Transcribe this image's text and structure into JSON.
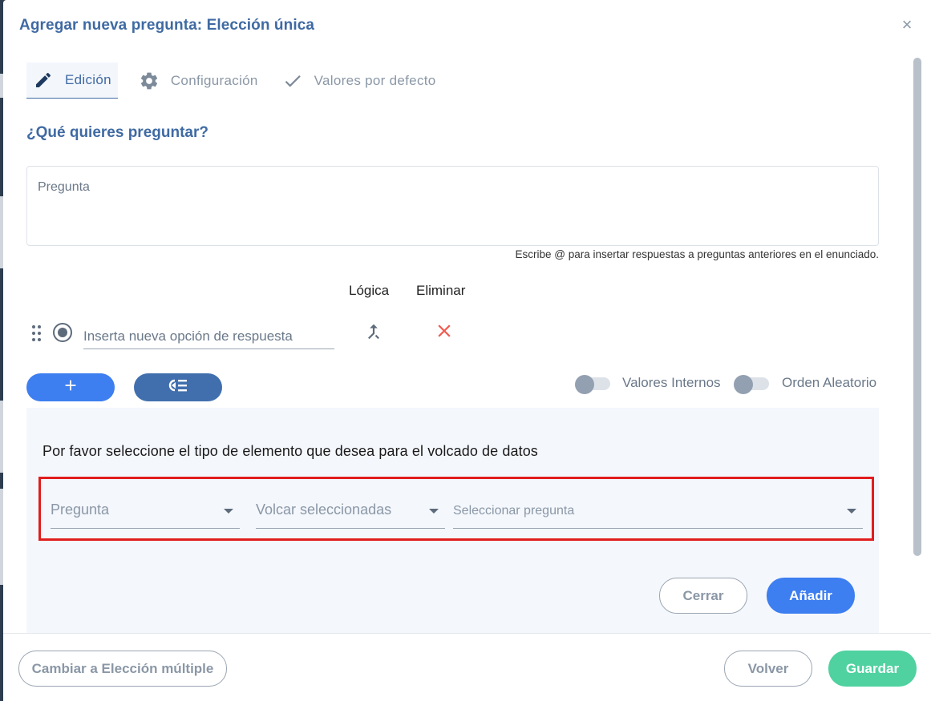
{
  "dialog": {
    "title": "Agregar nueva pregunta: Elección única",
    "close_glyph": "×"
  },
  "tabs": [
    {
      "label": "Edición",
      "icon": "pencil-icon",
      "active": true
    },
    {
      "label": "Configuración",
      "icon": "gear-icon",
      "active": false
    },
    {
      "label": "Valores por defecto",
      "icon": "check-icon",
      "active": false
    }
  ],
  "question": {
    "section_title": "¿Qué quieres preguntar?",
    "placeholder": "Pregunta",
    "hint": "Escribe @ para insertar respuestas a preguntas anteriores en el enunciado."
  },
  "options": {
    "col_logic": "Lógica",
    "col_delete": "Eliminar",
    "new_option_placeholder": "Inserta nueva opción de respuesta"
  },
  "actions": {
    "add_icon": "plus-icon",
    "bulk_icon": "list-insert-icon"
  },
  "toggles": [
    {
      "label": "Valores Internos",
      "on": false
    },
    {
      "label": "Orden Aleatorio",
      "on": false
    }
  ],
  "dump_panel": {
    "prompt": "Por favor seleccione el tipo de elemento que desea para el volcado de datos",
    "element_type": "Pregunta",
    "dump_mode": "Volcar seleccionadas",
    "question_select": "Seleccionar pregunta",
    "close_label": "Cerrar",
    "add_label": "Añadir"
  },
  "footer": {
    "switch_label": "Cambiar a Elección múltiple",
    "back_label": "Volver",
    "save_label": "Guardar"
  },
  "colors": {
    "primary_blue": "#3d7ef0",
    "title_blue": "#3f6aa3",
    "save_green": "#4fd1a0",
    "delete_red": "#f05a4f",
    "highlight_red": "#e11d1d"
  }
}
